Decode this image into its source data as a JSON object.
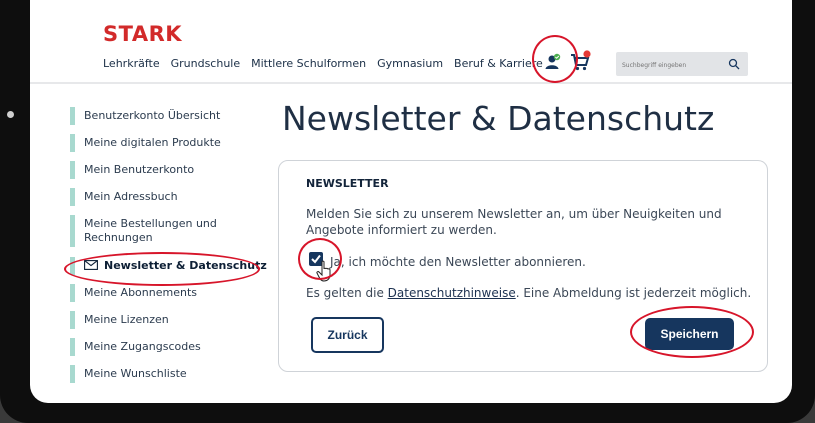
{
  "header": {
    "logo": "STARK",
    "nav": [
      "Lehrkräfte",
      "Grundschule",
      "Mittlere Schulformen",
      "Gymnasium",
      "Beruf & Karriere"
    ],
    "search_placeholder": "Suchbegriff eingeben",
    "colors": {
      "brand": "#d22a2a",
      "navy": "#16365e"
    }
  },
  "sidebar": {
    "items": [
      {
        "label": "Benutzerkonto Übersicht"
      },
      {
        "label": "Meine digitalen Produkte"
      },
      {
        "label": "Mein Benutzerkonto"
      },
      {
        "label": "Mein Adressbuch"
      },
      {
        "label": "Meine Bestellungen und Rechnungen"
      },
      {
        "label": "Newsletter & Datenschutz",
        "active": true
      },
      {
        "label": "Meine Abonnements"
      },
      {
        "label": "Meine Lizenzen"
      },
      {
        "label": "Meine Zugangscodes"
      },
      {
        "label": "Meine Wunschliste"
      }
    ]
  },
  "main": {
    "title": "Newsletter & Datenschutz",
    "card": {
      "heading": "NEWSLETTER",
      "intro": "Melden Sie sich zu unserem Newsletter an, um über Neuigkeiten und Angebote informiert zu werden.",
      "checkbox_label": "Ja, ich möchte den Newsletter abonnieren.",
      "checkbox_checked": true,
      "privacy_prefix": "Es gelten die ",
      "privacy_link": "Datenschutzhinweise",
      "privacy_suffix": ". Eine Abmeldung ist jederzeit möglich.",
      "back_label": "Zurück",
      "save_label": "Speichern"
    }
  }
}
